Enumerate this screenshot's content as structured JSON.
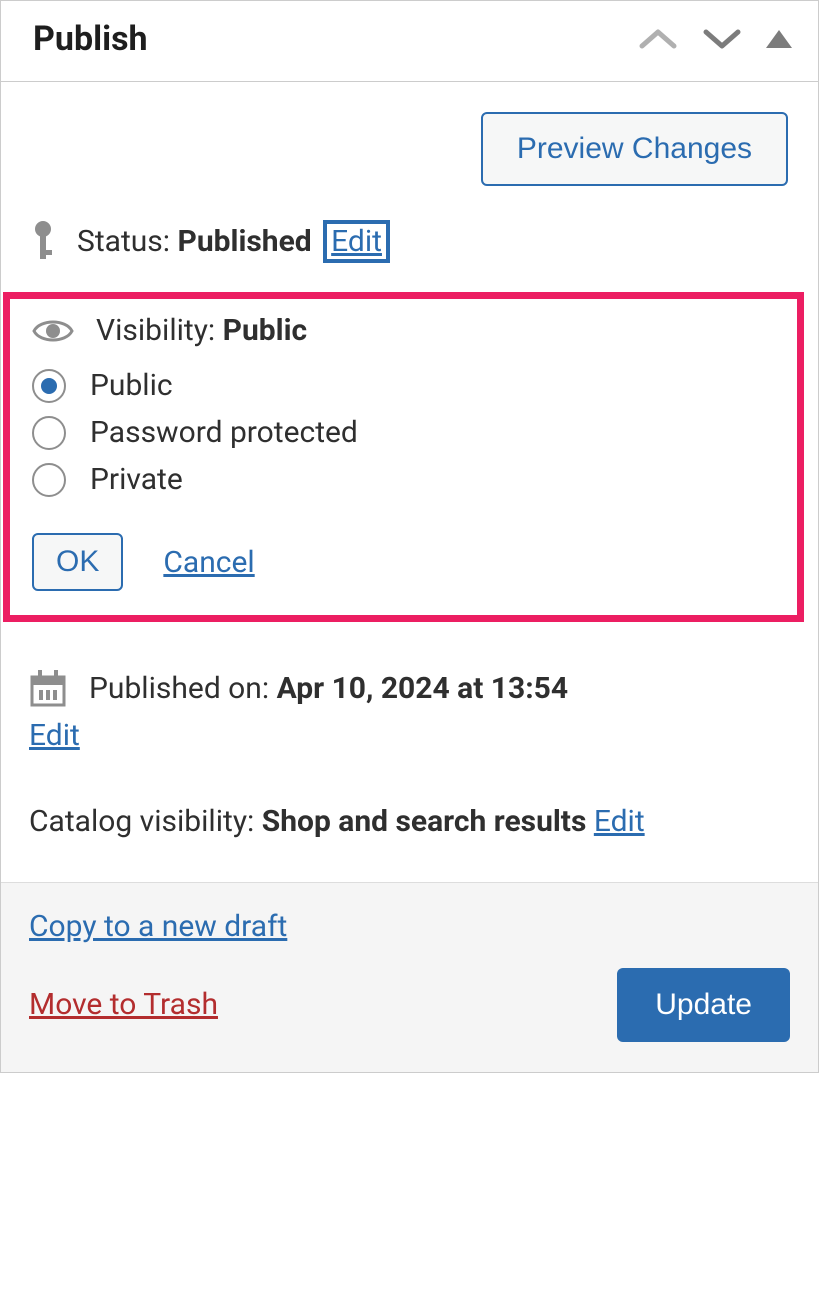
{
  "header": {
    "title": "Publish"
  },
  "preview_button": "Preview Changes",
  "status": {
    "label": "Status:",
    "value": "Published",
    "edit_label": "Edit"
  },
  "visibility": {
    "label": "Visibility:",
    "value": "Public",
    "options": [
      "Public",
      "Password protected",
      "Private"
    ],
    "ok_label": "OK",
    "cancel_label": "Cancel"
  },
  "published_on": {
    "label": "Published on:",
    "value": "Apr 10, 2024 at 13:54",
    "edit_label": "Edit"
  },
  "catalog_visibility": {
    "label": "Catalog visibility:",
    "value": "Shop and search results",
    "edit_label": "Edit"
  },
  "footer": {
    "copy_draft_label": "Copy to a new draft",
    "move_trash_label": "Move to Trash",
    "update_label": "Update"
  }
}
